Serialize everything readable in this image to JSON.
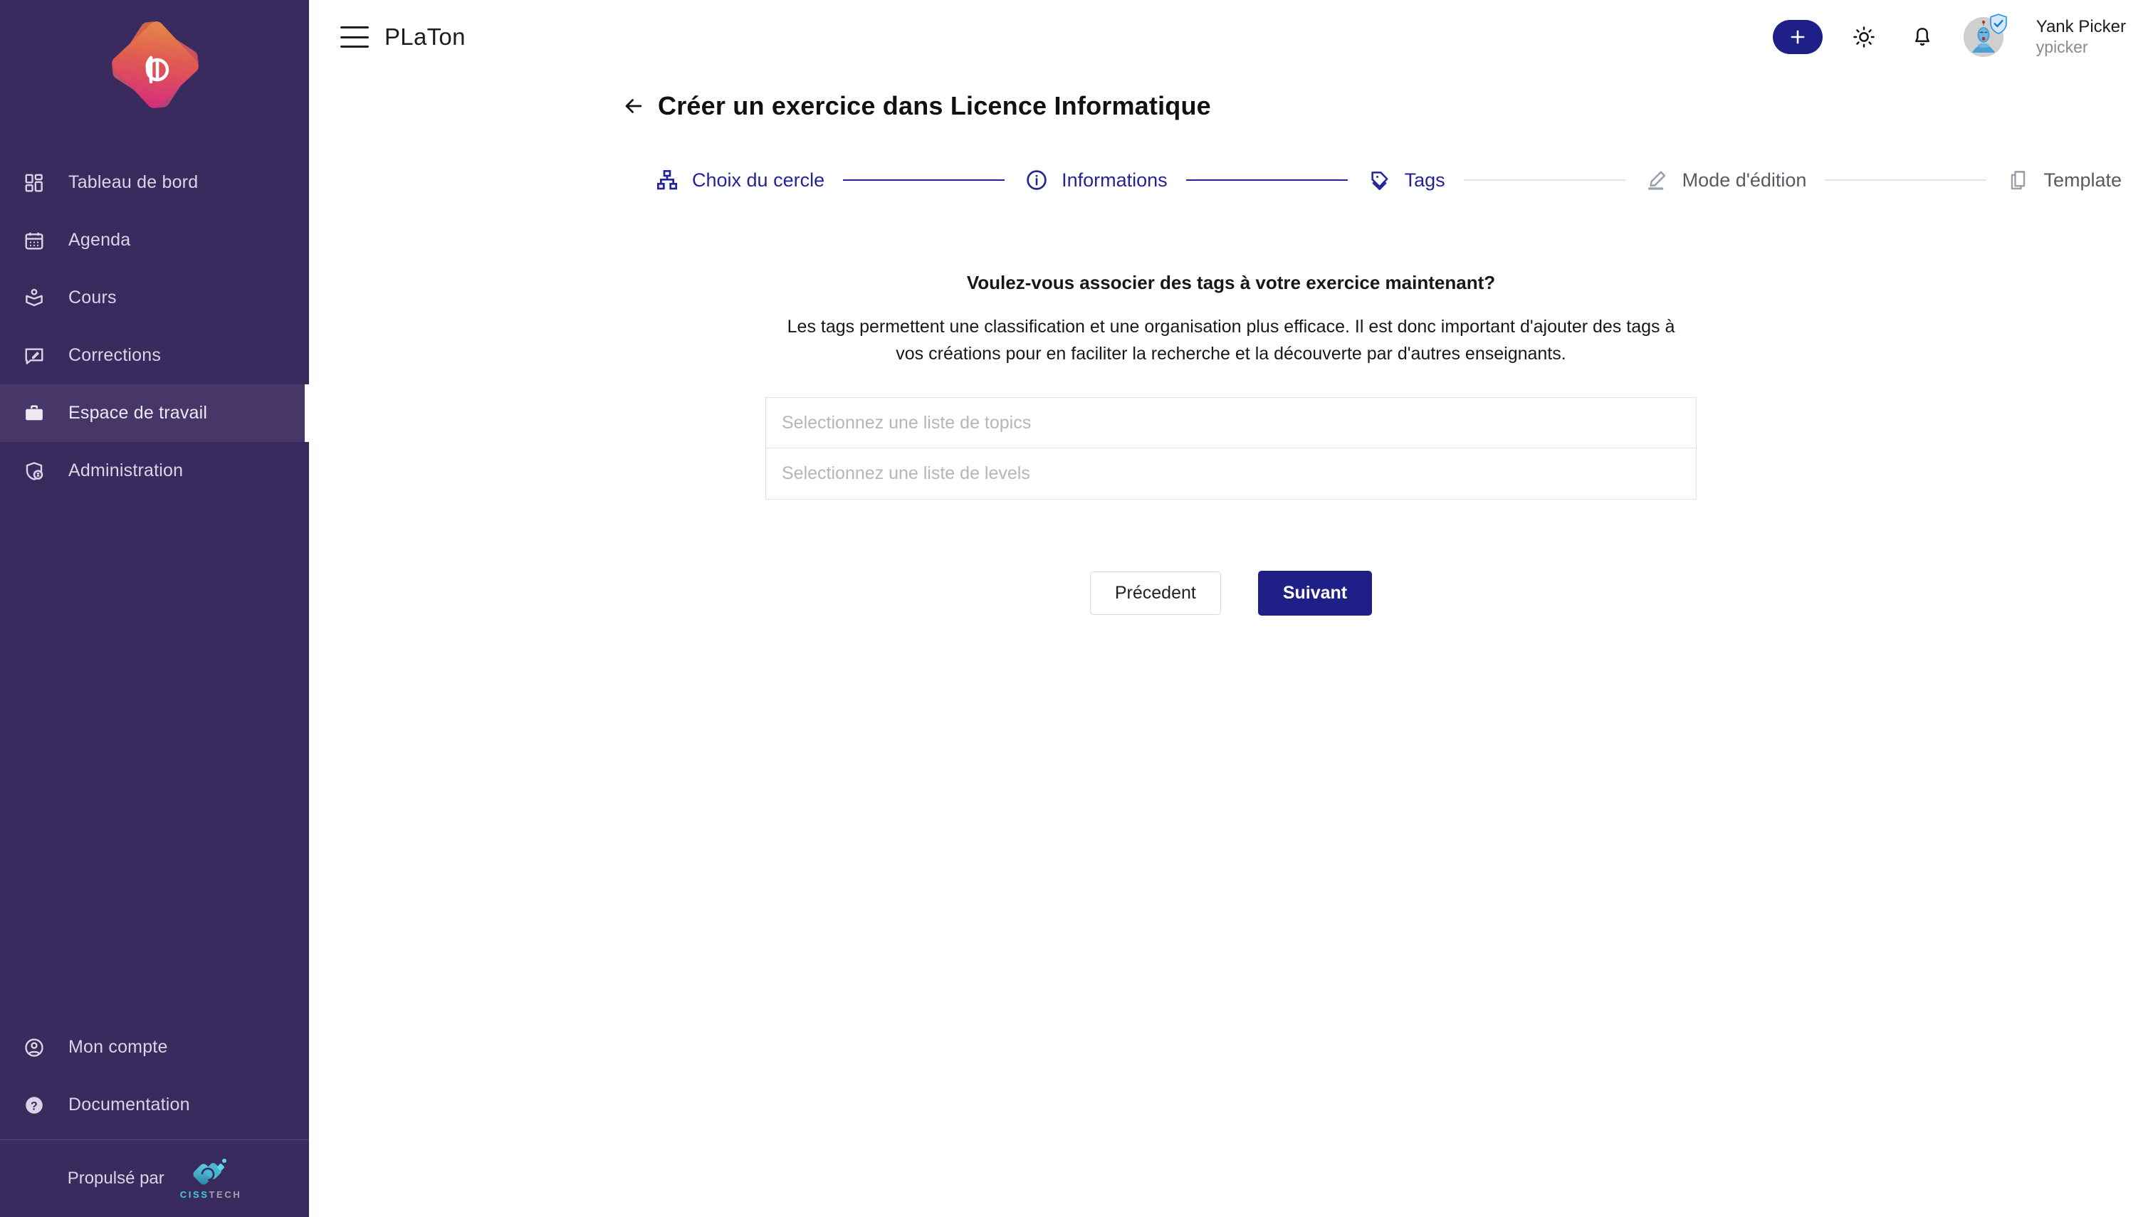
{
  "colors": {
    "sidebar_bg": "#3A2B5F",
    "sidebar_active_bg": "#473769",
    "accent_navy": "#1E2088",
    "step_active": "#23239b",
    "step_inactive": "#555a63",
    "placeholder": "#b6b6ba"
  },
  "sidebar": {
    "logo_name": "platon-logo",
    "items": [
      {
        "label": "Tableau de bord",
        "icon": "dashboard-icon",
        "active": false
      },
      {
        "label": "Agenda",
        "icon": "calendar-icon",
        "active": false
      },
      {
        "label": "Cours",
        "icon": "book-icon",
        "active": false
      },
      {
        "label": "Corrections",
        "icon": "comment-edit-icon",
        "active": false
      },
      {
        "label": "Espace de travail",
        "icon": "briefcase-icon",
        "active": true
      },
      {
        "label": "Administration",
        "icon": "shield-admin-icon",
        "active": false
      }
    ],
    "bottom_items": [
      {
        "label": "Mon compte",
        "icon": "account-circle-icon"
      },
      {
        "label": "Documentation",
        "icon": "help-circle-icon"
      }
    ],
    "footer": {
      "powered_label": "Propulsé par",
      "vendor_primary": "CISS",
      "vendor_secondary": "TECH",
      "vendor_logo": "cisstech-logo"
    }
  },
  "header": {
    "menu_icon": "hamburger-menu-icon",
    "brand": "PLaTon",
    "add_button_icon": "plus-icon",
    "theme_icon": "sun-icon",
    "notification_icon": "bell-icon",
    "avatar_icon": "user-avatar",
    "verified_icon": "verified-shield-icon",
    "user_name": "Yank Picker",
    "user_handle": "ypicker"
  },
  "page": {
    "back_icon": "arrow-left-icon",
    "title": "Créer un exercice dans Licence Informatique"
  },
  "stepper": {
    "steps": [
      {
        "label": "Choix du cercle",
        "icon": "sitemap-icon",
        "state": "done"
      },
      {
        "label": "Informations",
        "icon": "info-circle-icon",
        "state": "done"
      },
      {
        "label": "Tags",
        "icon": "tags-icon",
        "state": "current"
      },
      {
        "label": "Mode d'édition",
        "icon": "pencil-icon",
        "state": "todo"
      },
      {
        "label": "Template",
        "icon": "document-copy-icon",
        "state": "todo"
      }
    ]
  },
  "main": {
    "question": "Voulez-vous associer des tags à votre exercice maintenant?",
    "description": "Les tags permettent une classification et une organisation plus efficace. Il est donc important d'ajouter des tags à vos créations pour en faciliter la recherche et la découverte par d'autres enseignants.",
    "fields": [
      {
        "name": "topics",
        "placeholder": "Selectionnez une liste de topics",
        "value": ""
      },
      {
        "name": "levels",
        "placeholder": "Selectionnez une liste de levels",
        "value": ""
      }
    ],
    "buttons": {
      "previous": "Précedent",
      "next": "Suivant"
    }
  }
}
